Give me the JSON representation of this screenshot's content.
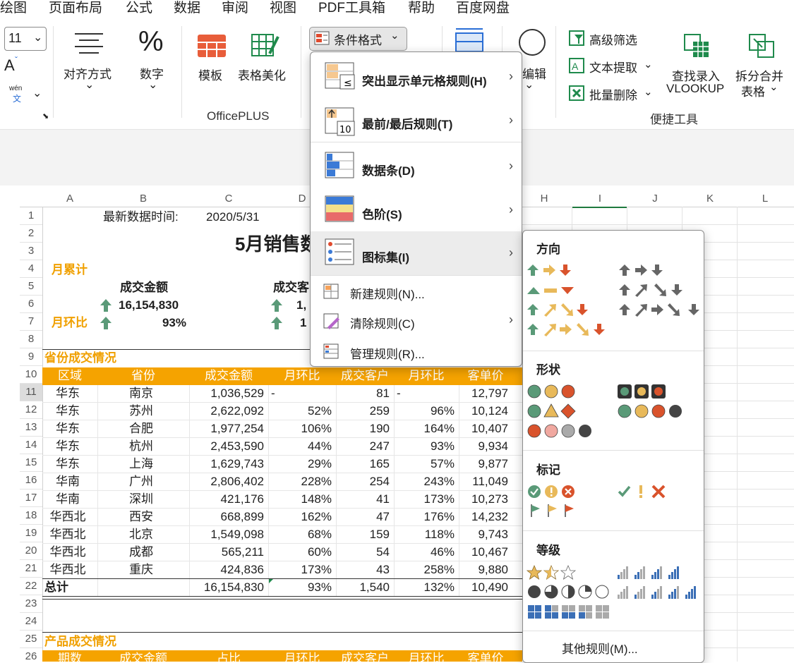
{
  "menu_tabs": [
    "绘图",
    "页面布局",
    "公式",
    "数据",
    "审阅",
    "视图",
    "PDF工具箱",
    "帮助",
    "百度网盘"
  ],
  "ribbon": {
    "font_size": "11",
    "align_label": "对齐方式",
    "number_label": "数字",
    "template_label": "模板",
    "beautify_label": "表格美化",
    "officeplus_group": "OfficePLUS",
    "cond_format_button": "条件格式",
    "edit_label": "编辑",
    "adv_filter": "高级筛选",
    "text_extract": "文本提取",
    "batch_delete": "批量删除",
    "vlookup_line1": "查找录入",
    "vlookup_line2": "VLOOKUP",
    "split_line1": "拆分合并",
    "split_line2": "表格",
    "quick_tools_group": "便捷工具",
    "wen_small": "wén",
    "wen_char": "文"
  },
  "columns": [
    "A",
    "B",
    "C",
    "D",
    "H",
    "I",
    "J",
    "K",
    "L"
  ],
  "rows": [
    "1",
    "2",
    "3",
    "4",
    "5",
    "6",
    "7",
    "8",
    "9",
    "10",
    "11",
    "12",
    "13",
    "14",
    "15",
    "16",
    "17",
    "18",
    "19",
    "20",
    "21",
    "22",
    "23",
    "24",
    "25",
    "26"
  ],
  "sheet": {
    "latest_label": "最新数据时间:",
    "latest_date": "2020/5/31",
    "title": "5月销售数",
    "month_total": "月累计",
    "amount_label": "成交金额",
    "customers_label": "成交客",
    "amount_value": "16,154,830",
    "cust_value_partial": "1,",
    "month_ratio": "月环比",
    "ratio_value": "93%",
    "cust_ratio_partial": "1",
    "province_section": "省份成交情况",
    "product_section": "产品成交情况",
    "table_headers": [
      "区域",
      "省份",
      "成交金额",
      "月环比",
      "成交客户",
      "月环比",
      "客单价"
    ],
    "table_rows": [
      [
        "华东",
        "南京",
        "1,036,529",
        "-",
        "81",
        "-",
        "12,797"
      ],
      [
        "华东",
        "苏州",
        "2,622,092",
        "52%",
        "259",
        "96%",
        "10,124"
      ],
      [
        "华东",
        "合肥",
        "1,977,254",
        "106%",
        "190",
        "164%",
        "10,407"
      ],
      [
        "华东",
        "杭州",
        "2,453,590",
        "44%",
        "247",
        "93%",
        "9,934"
      ],
      [
        "华东",
        "上海",
        "1,629,743",
        "29%",
        "165",
        "57%",
        "9,877"
      ],
      [
        "华南",
        "广州",
        "2,806,402",
        "228%",
        "254",
        "243%",
        "11,049"
      ],
      [
        "华南",
        "深圳",
        "421,176",
        "148%",
        "41",
        "173%",
        "10,273"
      ],
      [
        "华西北",
        "西安",
        "668,899",
        "162%",
        "47",
        "176%",
        "14,232"
      ],
      [
        "华西北",
        "北京",
        "1,549,098",
        "68%",
        "159",
        "118%",
        "9,743"
      ],
      [
        "华西北",
        "成都",
        "565,211",
        "60%",
        "54",
        "46%",
        "10,467"
      ],
      [
        "华西北",
        "重庆",
        "424,836",
        "173%",
        "43",
        "258%",
        "9,880"
      ]
    ],
    "total_row": [
      "总计",
      "",
      "16,154,830",
      "93%",
      "1,540",
      "132%",
      "10,490"
    ],
    "product_headers_partial": [
      "期数",
      "成交金额",
      "占比",
      "月环比",
      "成交客户",
      "月环比",
      "客单价"
    ]
  },
  "cf_menu": {
    "items_big": [
      "突出显示单元格规则(H)",
      "最前/最后规则(T)",
      "数据条(D)",
      "色阶(S)",
      "图标集(I)"
    ],
    "items_small": [
      "新建规则(N)...",
      "清除规则(C)",
      "管理规则(R)..."
    ]
  },
  "icon_sets": {
    "direction_title": "方向",
    "shape_title": "形状",
    "mark_title": "标记",
    "level_title": "等级",
    "more_rules": "其他规则(M)..."
  },
  "colors": {
    "orange_header": "#f5a300",
    "green": "#5a9a78",
    "red": "#d9532c",
    "yellow": "#e8b95a",
    "blue": "#3b6fb6"
  }
}
